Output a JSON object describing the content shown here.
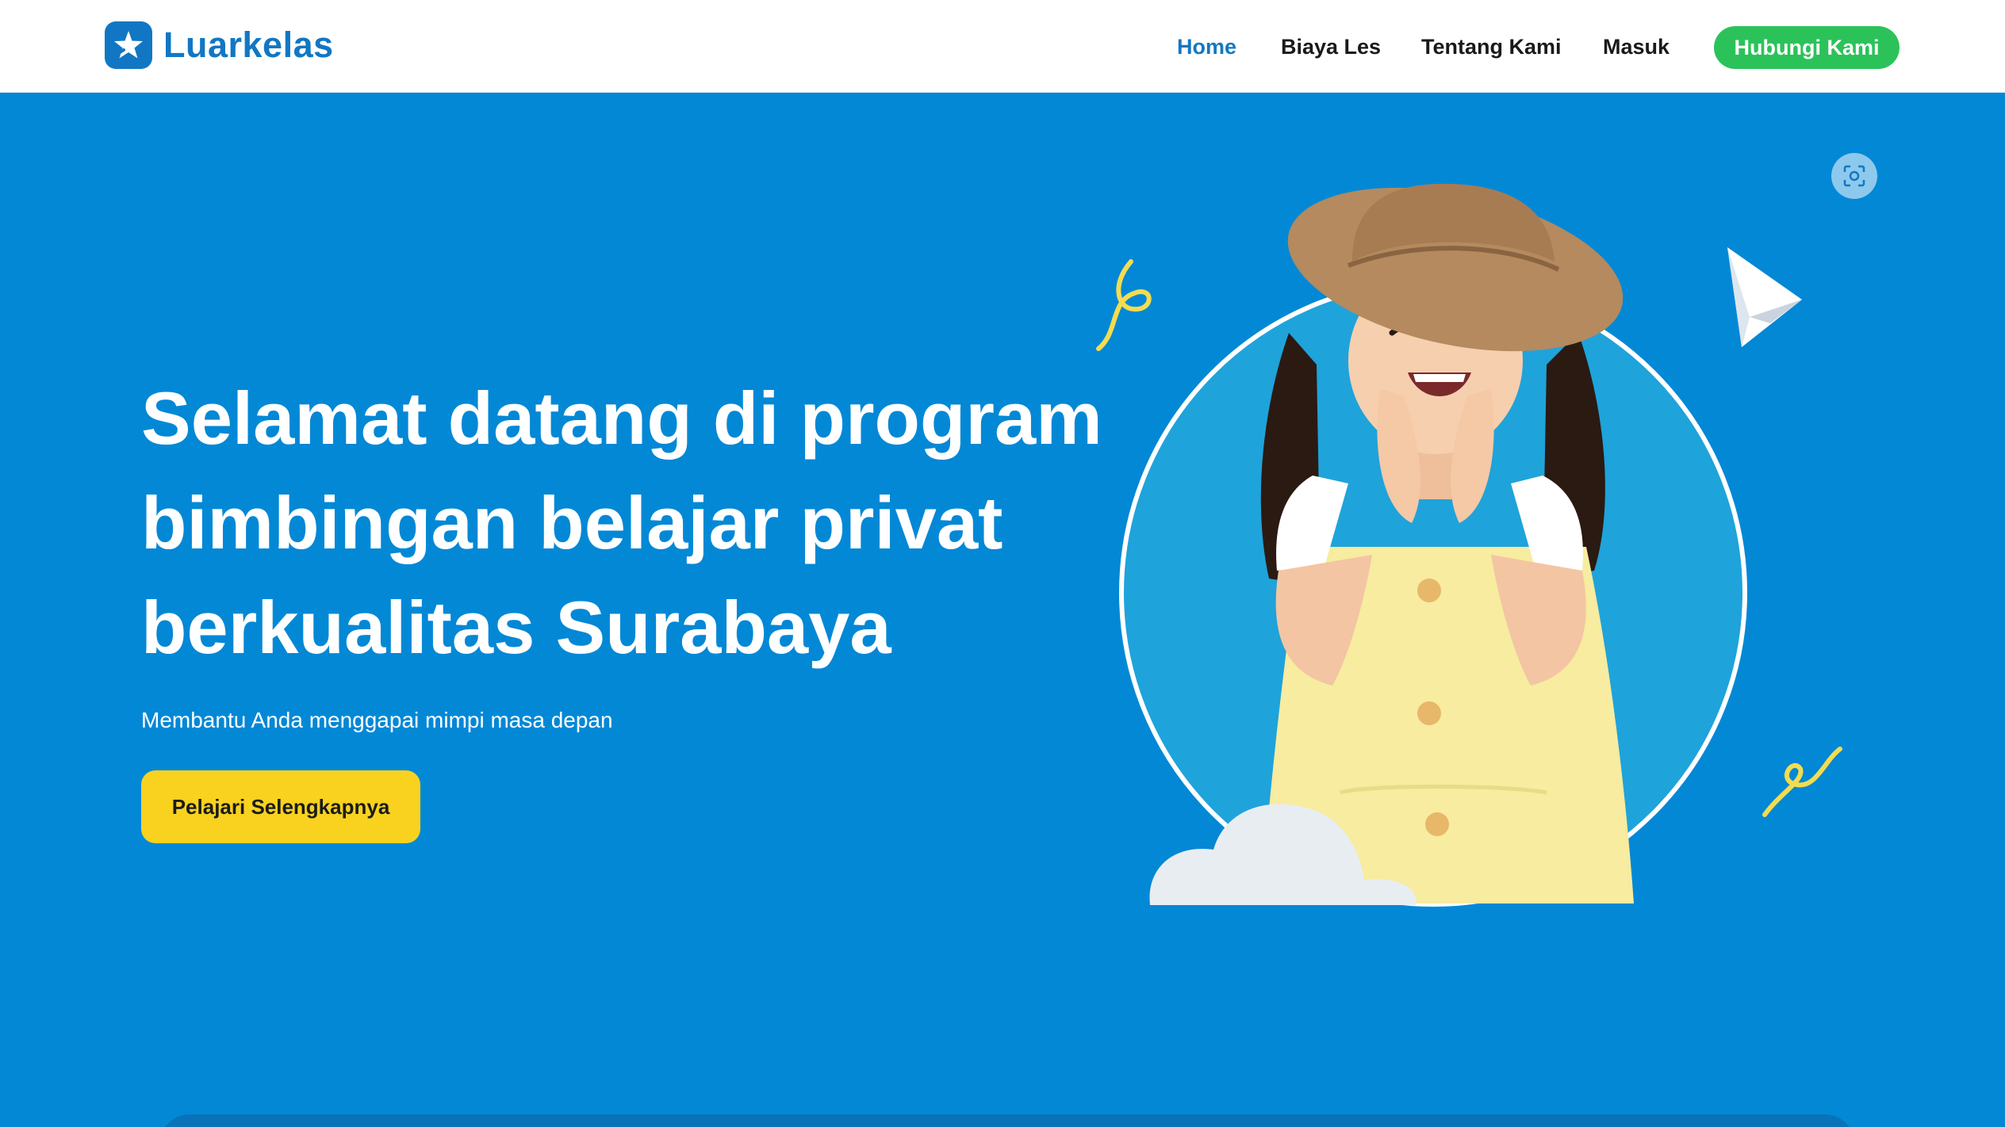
{
  "header": {
    "brand": "Luarkelas",
    "logo_icon": "star-icon",
    "nav": [
      {
        "label": "Home",
        "active": true
      },
      {
        "label": "Biaya Les",
        "active": false
      },
      {
        "label": "Tentang Kami",
        "active": false
      },
      {
        "label": "Masuk",
        "active": false
      }
    ],
    "cta_label": "Hubungi Kami"
  },
  "hero": {
    "title_line1": "Selamat datang di program",
    "title_line2": "bimbingan belajar privat",
    "title_line3": "berkualitas Surabaya",
    "subtitle": "Membantu Anda menggapai mimpi masa depan",
    "button_label": "Pelajari Selengkapnya",
    "image_icon": "girl-illustration",
    "scan_icon": "scan-icon"
  },
  "colors": {
    "brand": "#1177c4",
    "hero_bg": "#0388d6",
    "cta_green": "#2cc25a",
    "button_yellow": "#f8d21f",
    "circle_bg": "#1fa3db"
  }
}
